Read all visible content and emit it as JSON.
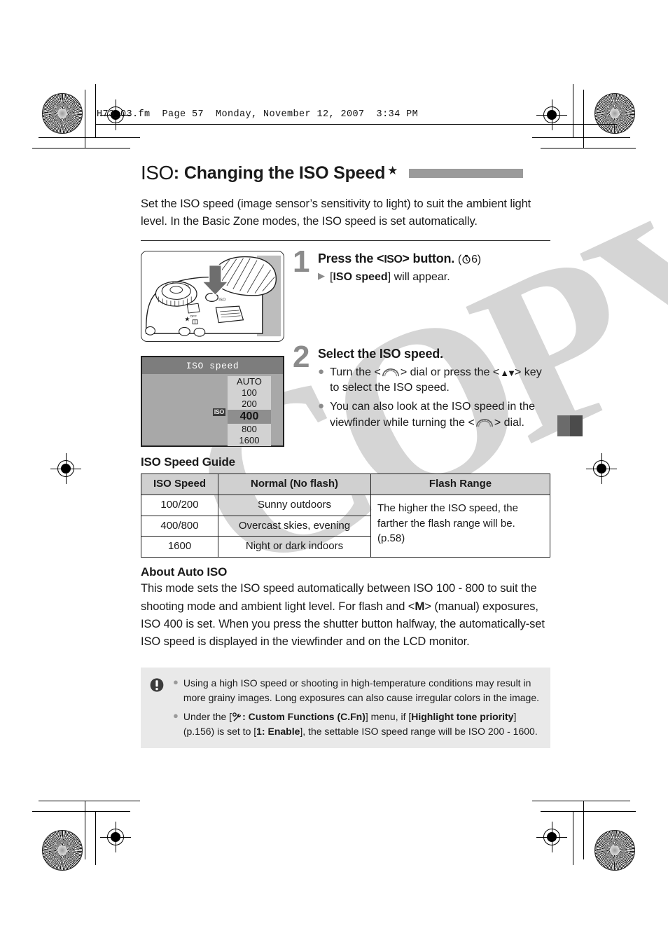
{
  "doc_header": "H73_03.fm  Page 57  Monday, November 12, 2007  3:34 PM",
  "watermark": "COPY",
  "page_number": "57",
  "title": {
    "iso_symbol": "ISO",
    "colon": ":",
    "text": "Changing the ISO Speed",
    "star": "★"
  },
  "intro": "Set the ISO speed (image sensor’s sensitivity to light) to suit the ambient light level. In the Basic Zone modes, the ISO speed is set automatically.",
  "steps": [
    {
      "number": "1",
      "title_pre": "Press the <",
      "title_glyph": "ISO",
      "title_post": "> button.",
      "title_paren_open": "(",
      "title_paren_timer": "⏱",
      "title_paren_value": "6",
      "title_paren_close": ")",
      "bullets": [
        {
          "marker": "▶",
          "pre": "[",
          "bold": "ISO speed",
          "post": "] will appear."
        }
      ]
    },
    {
      "number": "2",
      "title": "Select the ISO speed.",
      "bullets": [
        {
          "marker": "●",
          "text_1": "Turn the <",
          "glyph_1": "main-dial",
          "text_2": "> dial or press the <",
          "glyph_2": "up-down-key",
          "text_3": "> key to select the ISO speed."
        },
        {
          "marker": "●",
          "text_1": "You can also look at the ISO speed in the viewfinder while turning the <",
          "glyph_1": "main-dial",
          "text_2": "> dial."
        }
      ]
    }
  ],
  "camera_figure": {
    "caption": "camera-top-illustration",
    "callout": "down-arrow-to-iso-button"
  },
  "lcd": {
    "title": "ISO speed",
    "badge": "ISO",
    "options": [
      "AUTO",
      "100",
      "200",
      "400",
      "800",
      "1600"
    ],
    "selected": "400"
  },
  "guide": {
    "heading": "ISO Speed Guide",
    "columns": [
      "ISO Speed",
      "Normal (No flash)",
      "Flash Range"
    ],
    "rows": [
      [
        "100/200",
        "Sunny outdoors"
      ],
      [
        "400/800",
        "Overcast skies, evening"
      ],
      [
        "1600",
        "Night or dark indoors"
      ]
    ],
    "flash_range_text": "The higher the ISO speed, the farther the flash range will be.",
    "flash_range_page": "(p.58)"
  },
  "about": {
    "heading": "About Auto ISO",
    "part_1": "This mode sets the ISO speed automatically between ISO 100 - 800 to suit the shooting mode and ambient light level. For flash and <",
    "glyph_m": "M",
    "part_2": "> (manual) exposures, ISO 400 is set. When you press the shutter button halfway, the automatically-set ISO speed is displayed in the viewfinder and on the LCD monitor."
  },
  "caution": {
    "icon": "warning-exclamation-icon",
    "items": [
      {
        "text": "Using a high ISO speed or shooting in high-temperature conditions may result in more grainy images. Long exposures can also cause irregular colors in the image."
      },
      {
        "p1": "Under the [",
        "glyph": "wrench-icon",
        "b1": ": Custom Functions (C.Fn)",
        "p2": "] menu, if [",
        "b2": "Highlight tone priority",
        "p3": "] (p.156) is set to [",
        "b3": "1: Enable",
        "p4": "], the settable ISO speed range will be ISO 200 - 1600."
      }
    ]
  },
  "colors": {
    "title_bar": "#9a9a9a",
    "step_number": "#8b8b8b",
    "table_header_bg": "#d0d0d0",
    "caution_bg": "#e9e9e9",
    "lcd_bg": "#a8a8a8",
    "watermark": "#d5d5d5"
  }
}
